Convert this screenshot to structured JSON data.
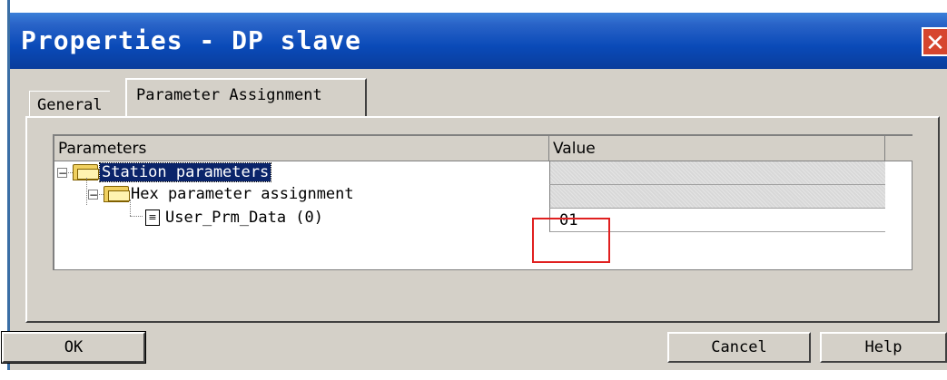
{
  "window": {
    "title": "Properties - DP slave",
    "close_glyph": "✕"
  },
  "tabs": [
    {
      "label": "General",
      "active": false
    },
    {
      "label": "Parameter Assignment",
      "active": true
    }
  ],
  "grid": {
    "columns": [
      "Parameters",
      "Value"
    ],
    "rows": [
      {
        "label": "Station parameters",
        "value": "",
        "level": 0,
        "icon": "folder-icon",
        "expander": "−",
        "selected": true
      },
      {
        "label": "Hex parameter assignment",
        "value": "",
        "level": 1,
        "icon": "folder-icon",
        "expander": "−",
        "selected": false
      },
      {
        "label": "User_Prm_Data (0)",
        "value": "01",
        "level": 2,
        "icon": "document-icon",
        "selected": false
      }
    ]
  },
  "buttons": {
    "ok": "OK",
    "cancel": "Cancel",
    "help": "Help"
  },
  "colors": {
    "title_bar": "#0a4ab8",
    "highlight": "#0a246a",
    "annotation_box": "#e02020",
    "dialog_bg": "#d4d0c8"
  }
}
